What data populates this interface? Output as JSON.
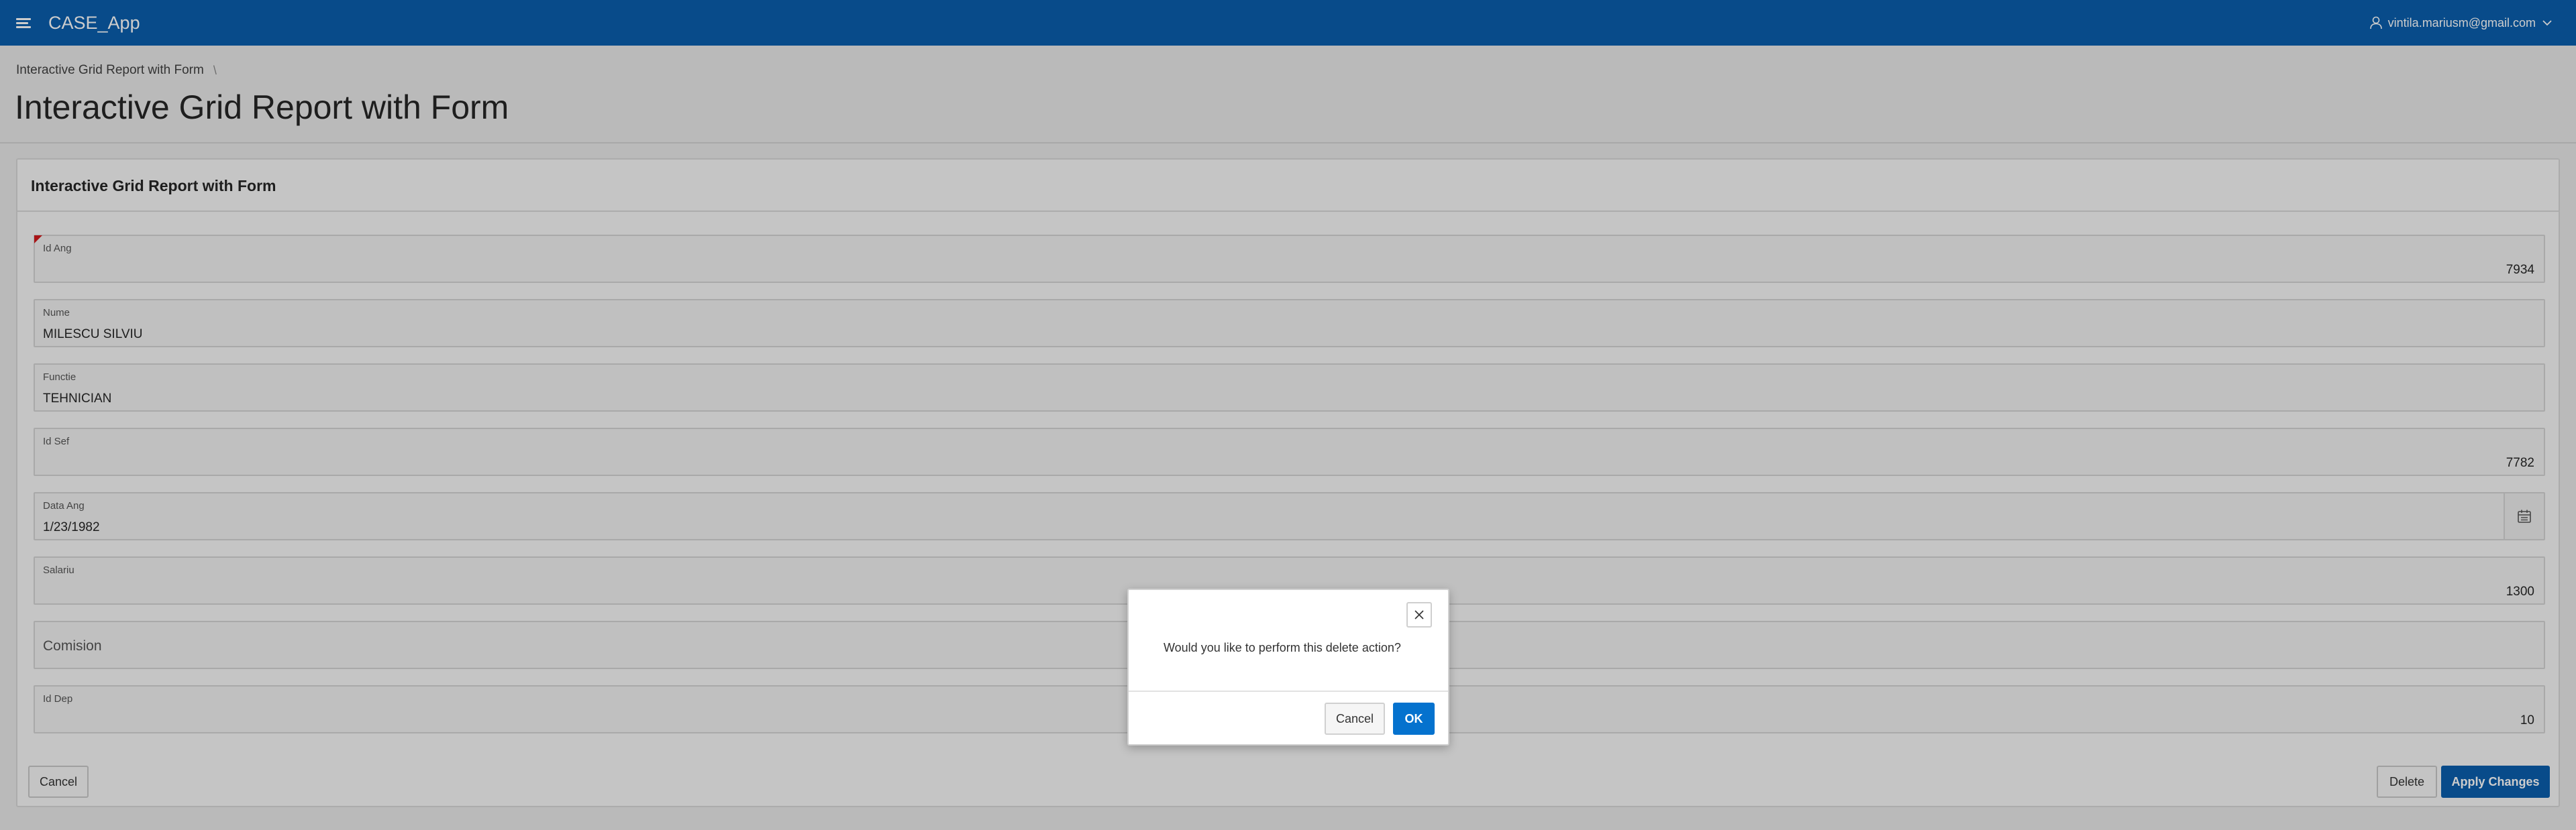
{
  "header": {
    "app_title": "CASE_App",
    "user": "vintila.mariusm@gmail.com",
    "menu_icon": "hamburger-icon",
    "user_icon": "user-icon",
    "caret_icon": "chevron-down-icon",
    "color": "#0b5ead"
  },
  "breadcrumb": {
    "item": "Interactive Grid Report with Form",
    "separator": "\\"
  },
  "page_title": "Interactive Grid Report with Form",
  "region": {
    "title": "Interactive Grid Report with Form",
    "fields": {
      "id_ang": {
        "label": "Id Ang",
        "value": "7934"
      },
      "nume": {
        "label": "Nume",
        "value": "MILESCU SILVIU"
      },
      "functie": {
        "label": "Functie",
        "value": "TEHNICIAN"
      },
      "id_sef": {
        "label": "Id Sef",
        "value": "7782"
      },
      "data_ang": {
        "label": "Data Ang",
        "value": "1/23/1982",
        "icon": "calendar-icon"
      },
      "salariu": {
        "label": "Salariu",
        "value": "1300"
      },
      "comision": {
        "label": "Comision",
        "value": ""
      },
      "id_dep": {
        "label": "Id Dep",
        "value": "10"
      }
    },
    "buttons": {
      "cancel": "Cancel",
      "delete": "Delete",
      "apply": "Apply Changes"
    }
  },
  "dialog": {
    "message": "Would you like to perform this delete action?",
    "cancel": "Cancel",
    "ok": "OK",
    "close_icon": "close-icon"
  }
}
